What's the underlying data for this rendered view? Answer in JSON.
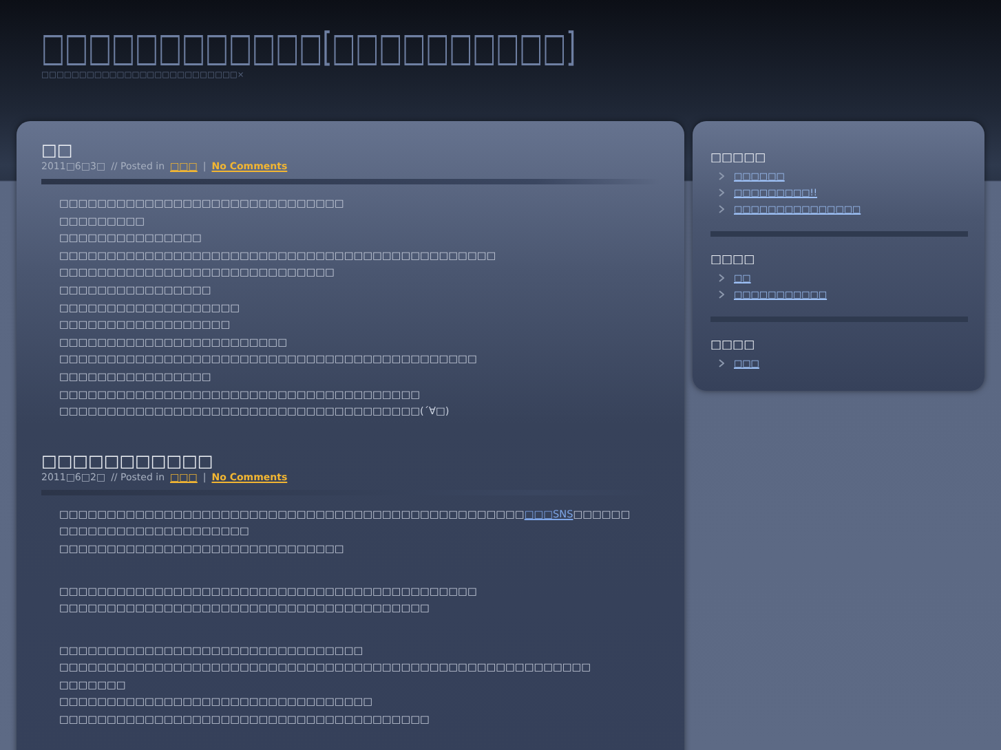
{
  "site": {
    "title": "□□□□□□□□□□□□[□□□□□□□□□□]",
    "tagline": "□□□□□□□□□□□□□□□□□□□□□□□□□□×"
  },
  "posts": [
    {
      "title": "□□",
      "date": "2011□6□3□",
      "posted_in": "// Posted in",
      "category": "□□□",
      "separator": "|",
      "comments": "No Comments",
      "paragraphs": [
        [
          {
            "kind": "text",
            "text": "□□□□□□□□□□□□□□□□□□□□□□□□□□□□□□"
          },
          {
            "kind": "text",
            "text": "□□□□□□□□□"
          },
          {
            "kind": "text",
            "text": "□□□□□□□□□□□□□□□"
          },
          {
            "kind": "text",
            "text": "□□□□□□□□□□□□□□□□□□□□□□□□□□□□□□□□□□□□□□□□□□□□□□"
          },
          {
            "kind": "text",
            "text": "□□□□□□□□□□□□□□□□□□□□□□□□□□□□□"
          },
          {
            "kind": "text",
            "text": "□□□□□□□□□□□□□□□□"
          },
          {
            "kind": "text",
            "text": "□□□□□□□□□□□□□□□□□□□"
          },
          {
            "kind": "text",
            "text": "□□□□□□□□□□□□□□□□□□"
          },
          {
            "kind": "text",
            "text": "□□□□□□□□□□□□□□□□□□□□□□□□"
          },
          {
            "kind": "text",
            "text": "□□□□□□□□□□□□□□□□□□□□□□□□□□□□□□□□□□□□□□□□□□□□"
          },
          {
            "kind": "text",
            "text": "□□□□□□□□□□□□□□□□"
          },
          {
            "kind": "text",
            "text": "□□□□□□□□□□□□□□□□□□□□□□□□□□□□□□□□□□□□□□"
          },
          {
            "kind": "text",
            "text": "□□□□□□□□□□□□□□□□□□□□□□□□□□□□□□□□□□□□□□(´∀□)"
          }
        ]
      ]
    },
    {
      "title": "□□□□□□□□□□□",
      "date": "2011□6□2□",
      "posted_in": "// Posted in",
      "category": "□□□",
      "separator": "|",
      "comments": "No Comments",
      "paragraphs": [
        [
          {
            "kind": "link",
            "before": "□□□□□□□□□□□□□□□□□□□□□□□□□□□□□□□□□□□□□□□□□□□□□□□□□",
            "link": "□□□SNS",
            "after": "□□□□□□"
          },
          {
            "kind": "text",
            "text": "□□□□□□□□□□□□□□□□□□□□"
          },
          {
            "kind": "text",
            "text": "□□□□□□□□□□□□□□□□□□□□□□□□□□□□□□"
          }
        ],
        [
          {
            "kind": "text",
            "text": "□□□□□□□□□□□□□□□□□□□□□□□□□□□□□□□□□□□□□□□□□□□□"
          },
          {
            "kind": "text",
            "text": "□□□□□□□□□□□□□□□□□□□□□□□□□□□□□□□□□□□□□□□"
          }
        ],
        [
          {
            "kind": "text",
            "text": "□□□□□□□□□□□□□□□□□□□□□□□□□□□□□□□□"
          },
          {
            "kind": "text",
            "text": "□□□□□□□□□□□□□□□□□□□□□□□□□□□□□□□□□□□□□□□□□□□□□□□□□□□□□□□□"
          },
          {
            "kind": "text",
            "text": "□□□□□□□"
          },
          {
            "kind": "text",
            "text": "□□□□□□□□□□□□□□□□□□□□□□□□□□□□□□□□□"
          },
          {
            "kind": "text",
            "text": "□□□□□□□□□□□□□□□□□□□□□□□□□□□□□□□□□□□□□□□"
          }
        ]
      ]
    }
  ],
  "sidebar": [
    {
      "heading": "□□□□□",
      "items": [
        "□□□□□□",
        "□□□□□□□□□!!",
        "□□□□□□□□□□□□□□□"
      ]
    },
    {
      "heading": "□□□□",
      "items": [
        "□□",
        "□□□□□□□□□□□"
      ]
    },
    {
      "heading": "□□□□",
      "items": [
        "□□□"
      ]
    }
  ]
}
